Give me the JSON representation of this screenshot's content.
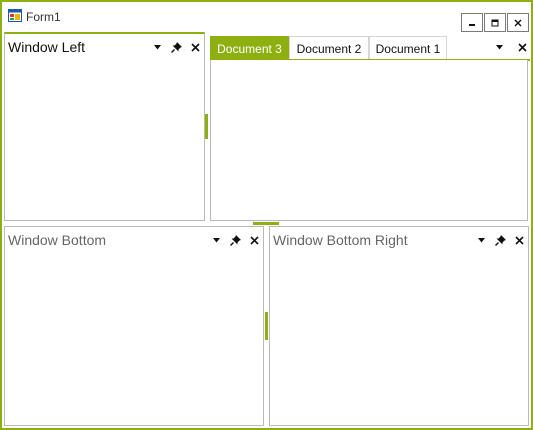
{
  "window": {
    "title": "Form1",
    "minimize_icon": "minimize-icon",
    "maximize_icon": "maximize-icon",
    "close_icon": "close-icon"
  },
  "panes": {
    "left": {
      "title": "Window Left",
      "state": "active"
    },
    "bottom": {
      "title": "Window Bottom",
      "state": "inactive"
    },
    "bottom_right": {
      "title": "Window Bottom Right",
      "state": "inactive"
    }
  },
  "documents": {
    "tabs": [
      {
        "label": "Document 3",
        "selected": true
      },
      {
        "label": "Document 2",
        "selected": false
      },
      {
        "label": "Document 1",
        "selected": false
      }
    ]
  },
  "icons": {
    "dropdown": "chevron-down-icon",
    "pin": "pin-icon",
    "close": "close-icon"
  },
  "colors": {
    "accent": "#8db010",
    "border": "#b9b9b9",
    "inactive_text": "#666666"
  }
}
